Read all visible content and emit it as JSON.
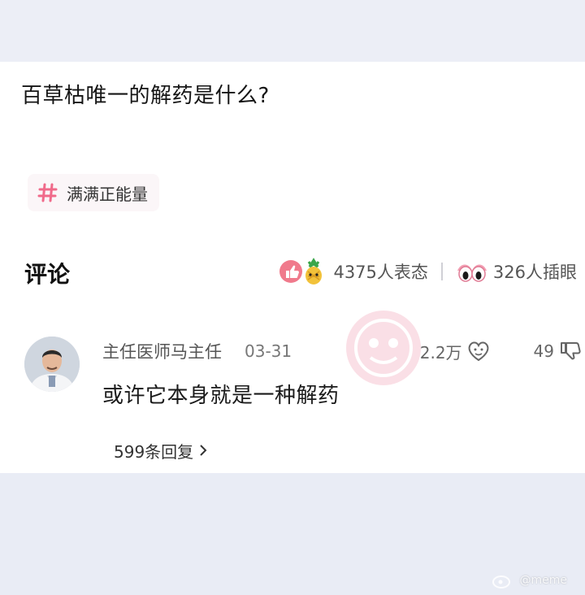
{
  "question": {
    "title": "百草枯唯一的解药是什么?"
  },
  "topic": {
    "label": "满满正能量",
    "icon": "hash-icon",
    "accent": "#f06a8a"
  },
  "comments_section": {
    "title": "评论",
    "reactions": {
      "count_label": "4375人表态",
      "icons": [
        "thumbs-up-icon",
        "pineapple-emoji-icon"
      ]
    },
    "eye_roll": {
      "count_label": "326人插眼",
      "icon": "eyes-icon"
    }
  },
  "comment": {
    "author": "主任医师马主任",
    "date": "03-31",
    "likes": "2.2万",
    "dislikes": "49",
    "text": "或许它本身就是一种解药",
    "replies_label": "599条回复",
    "avatar_icon": "doctor-avatar"
  },
  "watermark": {
    "text": "@meme"
  }
}
